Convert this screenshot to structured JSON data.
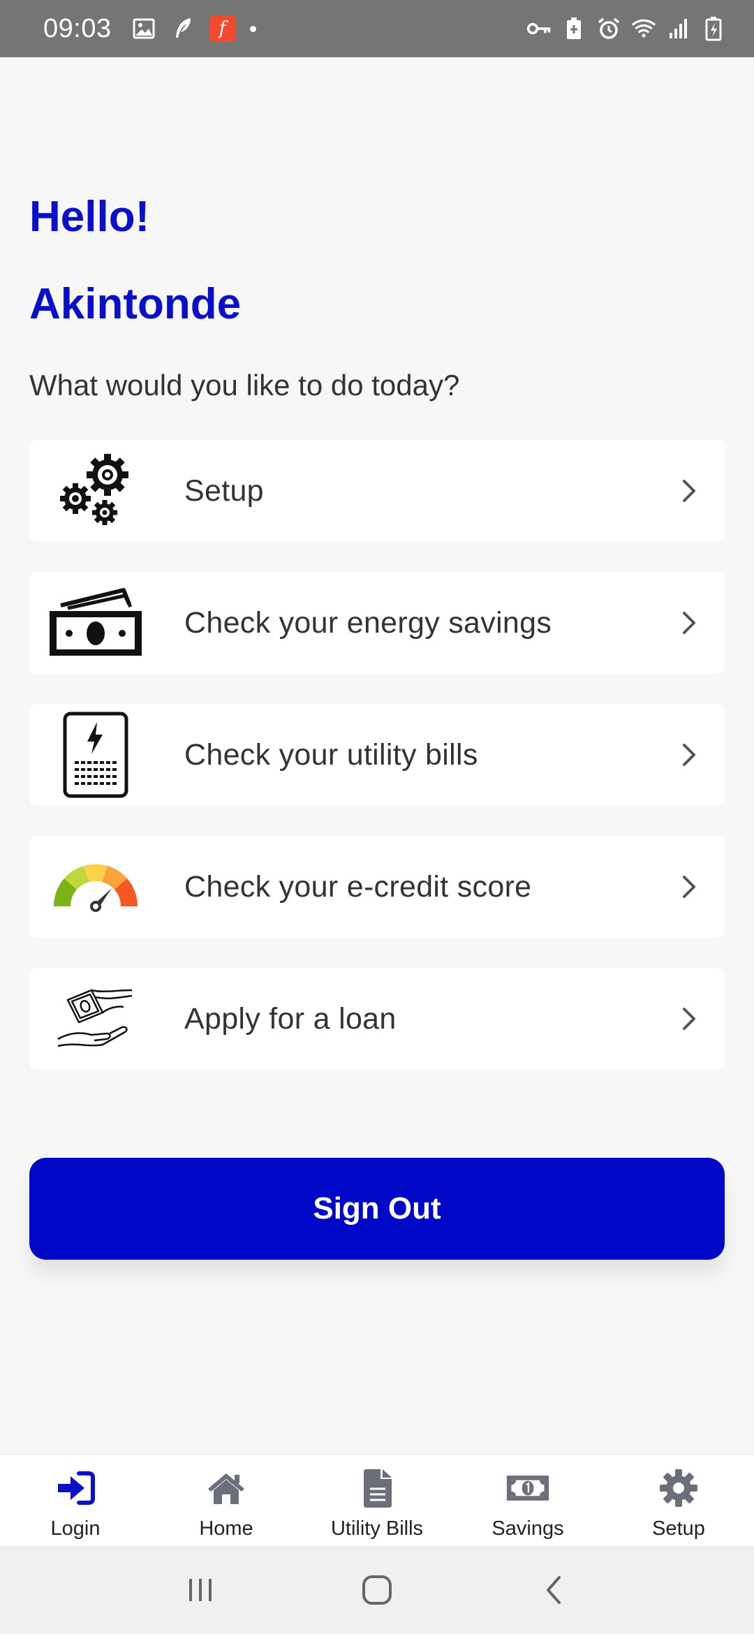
{
  "status_bar": {
    "time": "09:03",
    "left_icons": [
      "image-icon",
      "feather-icon",
      "flipboard-icon",
      "dot-icon"
    ],
    "right_icons": [
      "vpn-key-icon",
      "battery-saver-icon",
      "alarm-icon",
      "wifi-icon",
      "signal-icon",
      "battery-icon"
    ],
    "flipboard_letter": "f"
  },
  "greeting": {
    "line1": "Hello!",
    "line2": "Akintonde"
  },
  "prompt": "What would you like to do today?",
  "menu": [
    {
      "label": "Setup",
      "icon": "gears-icon"
    },
    {
      "label": "Check your energy savings",
      "icon": "money-icon"
    },
    {
      "label": "Check your utility bills",
      "icon": "bill-icon"
    },
    {
      "label": "Check your e-credit score",
      "icon": "gauge-icon"
    },
    {
      "label": "Apply for a loan",
      "icon": "loan-icon"
    }
  ],
  "sign_out_label": "Sign Out",
  "bottom_nav": [
    {
      "label": "Login",
      "icon": "login-icon",
      "active": true
    },
    {
      "label": "Home",
      "icon": "home-icon",
      "active": false
    },
    {
      "label": "Utility Bills",
      "icon": "document-icon",
      "active": false
    },
    {
      "label": "Savings",
      "icon": "money-bill-icon",
      "active": false
    },
    {
      "label": "Setup",
      "icon": "gear-icon",
      "active": false
    }
  ],
  "colors": {
    "accent": "#0a10c9",
    "button": "#0008c8",
    "status_bar": "#757575",
    "nav_inactive": "#6c6f7a"
  }
}
